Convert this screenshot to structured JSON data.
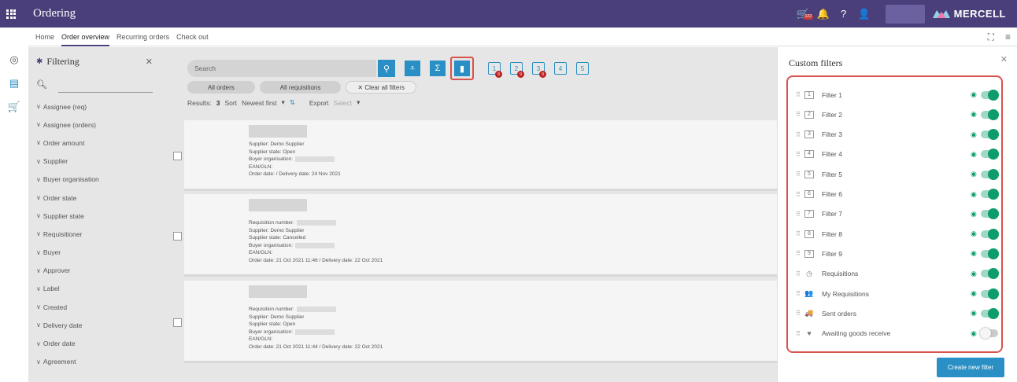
{
  "app": {
    "title": "Ordering",
    "cart_badge": "122",
    "brand": "MERCELL"
  },
  "nav": {
    "home": "Home",
    "order_overview": "Order overview",
    "recurring_orders": "Recurring orders",
    "check_out": "Check out"
  },
  "filtering": {
    "title": "Filtering",
    "items": [
      "Assignee (req)",
      "Assignee (orders)",
      "Order amount",
      "Supplier",
      "Buyer organisation",
      "Order state",
      "Supplier state",
      "Requisitioner",
      "Buyer",
      "Approver",
      "Label",
      "Created",
      "Delivery date",
      "Order date",
      "Agreement"
    ]
  },
  "toolbar": {
    "search_placeholder": "Search",
    "filter_buttons": [
      {
        "glyph": "1",
        "badge": "9"
      },
      {
        "glyph": "2",
        "badge": "9"
      },
      {
        "glyph": "3",
        "badge": "9"
      },
      {
        "glyph": "4",
        "badge": ""
      },
      {
        "glyph": "5",
        "badge": ""
      }
    ],
    "all_orders": "All orders",
    "all_requisitions": "All requisitions",
    "clear_all": "Clear all filters"
  },
  "results": {
    "label": "Results:",
    "count": "3",
    "sort_label": "Sort",
    "sort_value": "Newest first",
    "export_label": "Export",
    "export_select": "Select"
  },
  "cards": [
    {
      "lines": [
        "Supplier: Demo Supplier",
        "Supplier state: Open",
        "Buyer organisation:",
        "EAN/GLN:",
        "Order date:  / Delivery date: 24 Nov 2021"
      ]
    },
    {
      "lines": [
        "Requisition number:",
        "Supplier: Demo Supplier",
        "Supplier state: Cancelled",
        "Buyer organisation:",
        "EAN/GLN:",
        "Order date: 21 Oct 2021 11:46 / Delivery date: 22 Oct 2021"
      ]
    },
    {
      "lines": [
        "Requisition number:",
        "Supplier: Demo Supplier",
        "Supplier state: Open",
        "Buyer organisation:",
        "EAN/GLN:",
        "Order date: 21 Oct 2021 11:44 / Delivery date: 22 Oct 2021"
      ]
    }
  ],
  "custom_filters": {
    "title": "Custom filters",
    "create_button": "Create new filter",
    "items": [
      {
        "label": "Filter 1",
        "icon": "filter-1-icon",
        "glyph": "1",
        "enabled": true
      },
      {
        "label": "Filter 2",
        "icon": "filter-2-icon",
        "glyph": "2",
        "enabled": true
      },
      {
        "label": "Filter 3",
        "icon": "filter-3-icon",
        "glyph": "3",
        "enabled": true
      },
      {
        "label": "Filter 4",
        "icon": "filter-4-icon",
        "glyph": "4",
        "enabled": true
      },
      {
        "label": "Filter 5",
        "icon": "filter-5-icon",
        "glyph": "5",
        "enabled": true
      },
      {
        "label": "Filter 6",
        "icon": "filter-6-icon",
        "glyph": "6",
        "enabled": true
      },
      {
        "label": "Filter 7",
        "icon": "filter-7-icon",
        "glyph": "7",
        "enabled": true
      },
      {
        "label": "Filter 8",
        "icon": "filter-8-icon",
        "glyph": "8",
        "enabled": true
      },
      {
        "label": "Filter 9",
        "icon": "filter-9-icon",
        "glyph": "9",
        "enabled": true
      },
      {
        "label": "Requisitions",
        "icon": "requisitions-icon",
        "glyph": "◷",
        "enabled": true
      },
      {
        "label": "My Requisitions",
        "icon": "people-icon",
        "glyph": "👥",
        "enabled": true
      },
      {
        "label": "Sent orders",
        "icon": "truck-icon",
        "glyph": "🚚",
        "enabled": true
      },
      {
        "label": "Awaiting goods receive",
        "icon": "heart-icon",
        "glyph": "♥",
        "enabled": false
      }
    ]
  },
  "colors": {
    "topbar": "#4a3f7a",
    "accent": "#2a8fc4",
    "toggle_on": "#0d9c6b",
    "highlight": "#d9534f"
  }
}
